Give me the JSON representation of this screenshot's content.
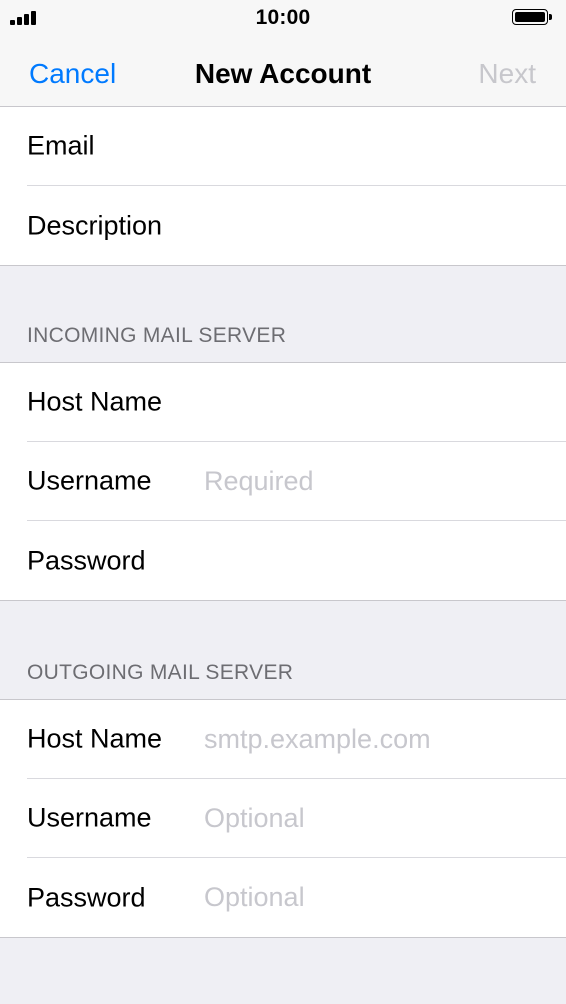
{
  "status_bar": {
    "time": "10:00",
    "icons": [
      "signal-icon",
      "battery-icon"
    ]
  },
  "nav": {
    "cancel_label": "Cancel",
    "title": "New Account",
    "next_label": "Next",
    "cancel_color": "#007aff",
    "next_color_disabled": "#c7c7cc"
  },
  "account": {
    "rows": [
      {
        "label": "Email",
        "value": "",
        "placeholder": ""
      },
      {
        "label": "Description",
        "value": "",
        "placeholder": ""
      }
    ]
  },
  "incoming": {
    "header": "INCOMING MAIL SERVER",
    "rows": [
      {
        "label": "Host Name",
        "value": "",
        "placeholder": ""
      },
      {
        "label": "Username",
        "value": "",
        "placeholder": "Required"
      },
      {
        "label": "Password",
        "value": "",
        "placeholder": ""
      }
    ]
  },
  "outgoing": {
    "header": "OUTGOING MAIL SERVER",
    "rows": [
      {
        "label": "Host Name",
        "value": "",
        "placeholder": "smtp.example.com"
      },
      {
        "label": "Username",
        "value": "",
        "placeholder": "Optional"
      },
      {
        "label": "Password",
        "value": "",
        "placeholder": "Optional"
      }
    ]
  }
}
